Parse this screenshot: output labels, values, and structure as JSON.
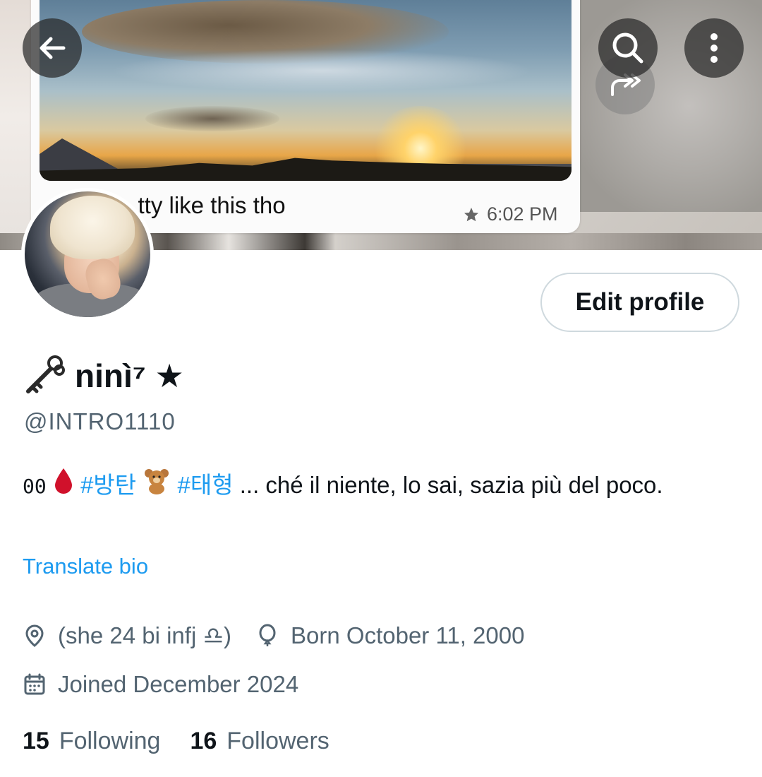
{
  "banner": {
    "caption": "...tty like this tho",
    "timestamp": "6:02 PM"
  },
  "nav": {
    "back_icon": "arrow-left-icon",
    "search_icon": "search-icon",
    "more_icon": "more-vertical-icon"
  },
  "profile": {
    "edit_label": "Edit profile",
    "display_name": "ninì⁷ ★",
    "handle": "@INTRO1110",
    "bio": {
      "prefix_symbol": "00",
      "drop_emoji": "🩸",
      "tag1": "#방탄",
      "bear_emoji": "🧸",
      "tag2": "#태형",
      "text": " ... ché il niente, lo sai, sazia più del poco."
    },
    "translate_label": "Translate bio",
    "location": "(she 24 bi infj ♎)",
    "birthday": "Born October 11, 2000",
    "joined": "Joined December 2024",
    "following_count": "15",
    "following_label": "Following",
    "followers_count": "16",
    "followers_label": "Followers"
  },
  "colors": {
    "accent": "#1d9bf0",
    "secondary_text": "#536471",
    "primary_text": "#0f1419"
  }
}
